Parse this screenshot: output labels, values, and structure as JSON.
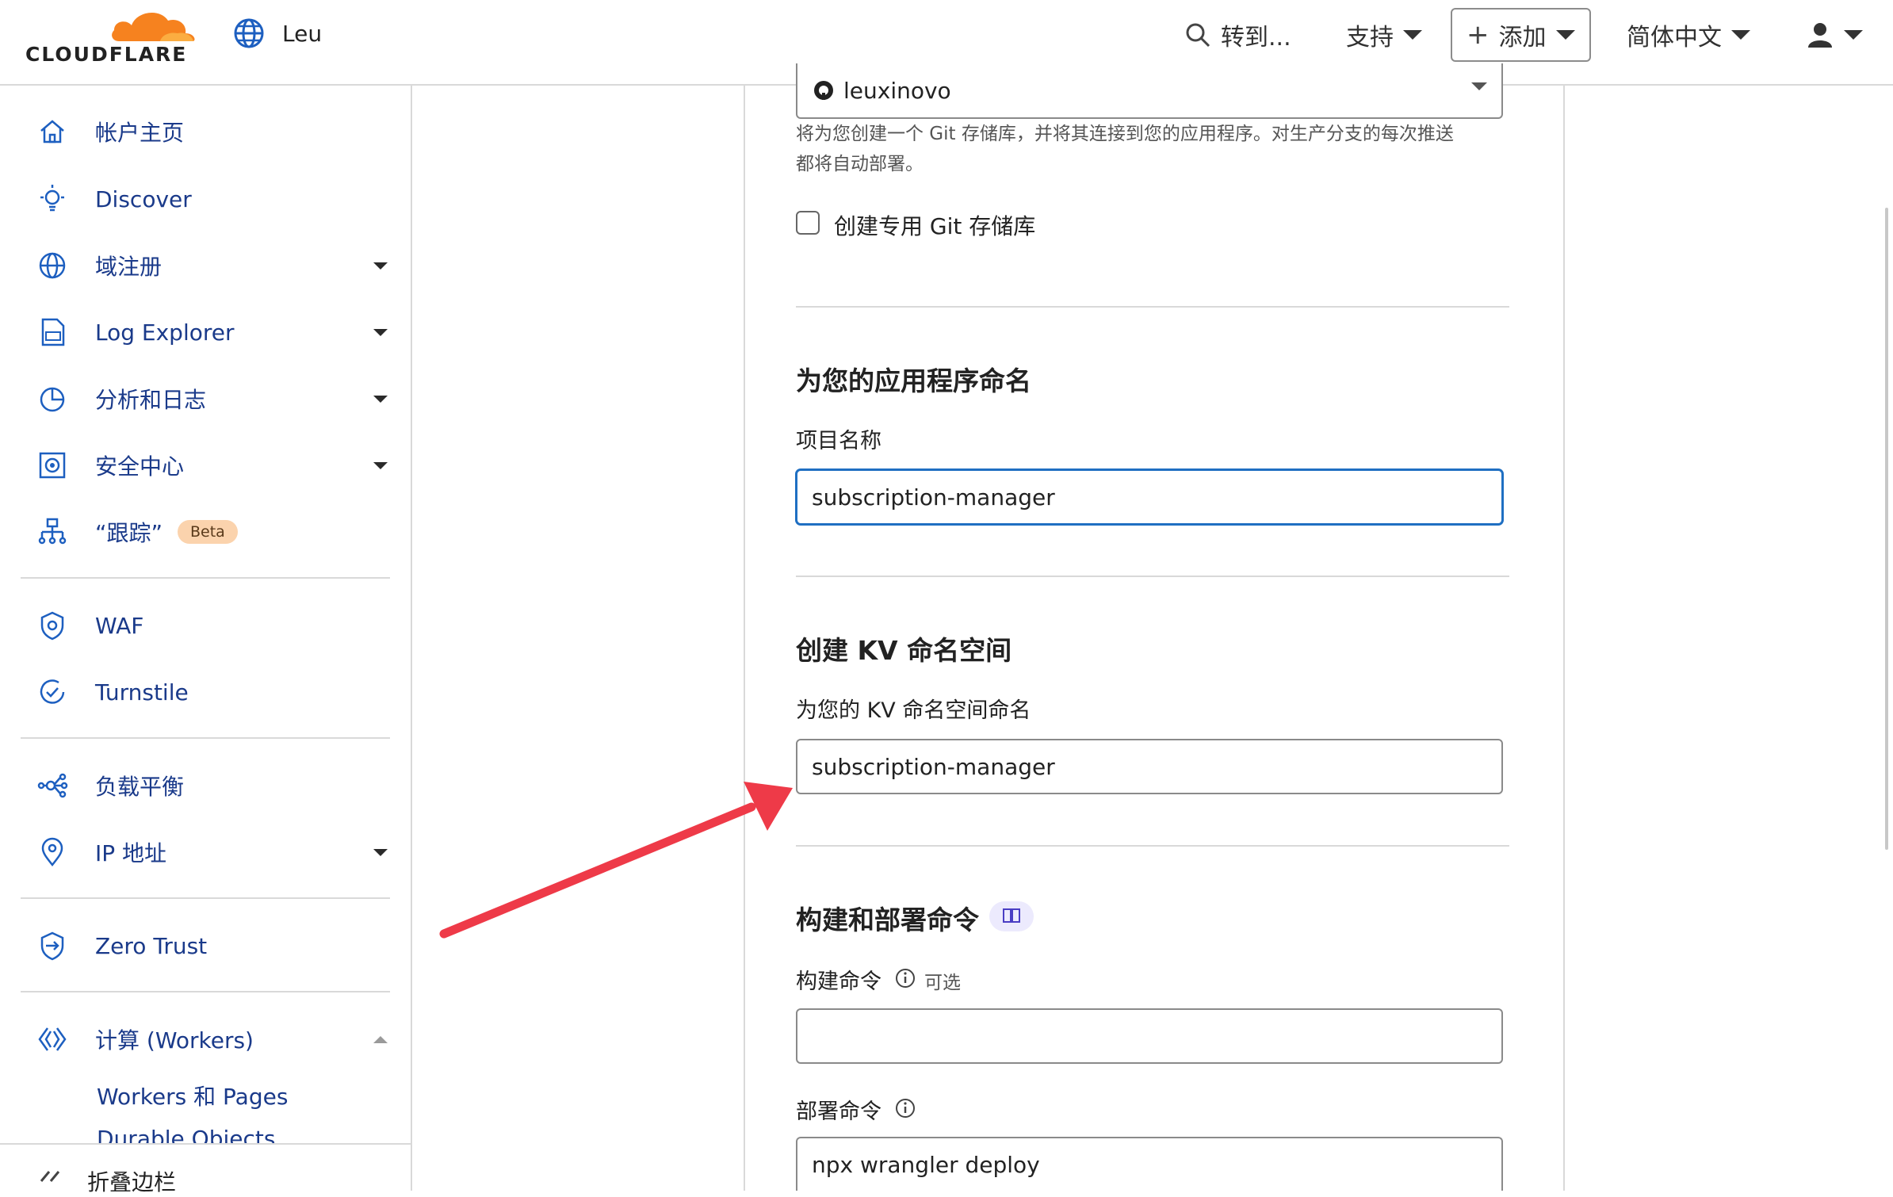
{
  "brand": {
    "logo_text": "CLOUDFLARE",
    "orange": "#f6821f"
  },
  "header": {
    "account_name": "Leu",
    "goto_label": "转到...",
    "support_label": "支持",
    "add_label": "添加",
    "language_label": "简体中文"
  },
  "sidebar": {
    "items": [
      {
        "label": "帐户主页",
        "icon": "home-icon"
      },
      {
        "label": "Discover",
        "icon": "lightbulb-icon"
      },
      {
        "label": "域注册",
        "icon": "globe-icon"
      },
      {
        "label": "Log Explorer",
        "icon": "log-file-icon"
      },
      {
        "label": "分析和日志",
        "icon": "pie-chart-icon"
      },
      {
        "label": "安全中心",
        "icon": "security-center-icon"
      },
      {
        "label": "“跟踪”",
        "icon": "trace-tree-icon",
        "badge": "Beta"
      },
      {
        "label": "WAF",
        "icon": "waf-shield-icon"
      },
      {
        "label": "Turnstile",
        "icon": "turnstile-icon"
      },
      {
        "label": "负载平衡",
        "icon": "load-balance-icon"
      },
      {
        "label": "IP 地址",
        "icon": "location-pin-icon"
      },
      {
        "label": "Zero Trust",
        "icon": "zero-trust-icon"
      },
      {
        "label": "计算 (Workers)",
        "icon": "workers-icon"
      }
    ],
    "sub_items": [
      "Workers 和 Pages",
      "Durable Objects"
    ],
    "collapse_label": "折叠边栏"
  },
  "form": {
    "repo_owner": "leuxinovo",
    "repo_help_line1": "将为您创建一个 Git 存储库，并将其连接到您的应用程序。对生产分支的每次推送",
    "repo_help_line2": "都将自动部署。",
    "private_repo_label": "创建专用 Git 存储库",
    "app_name_title": "为您的应用程序命名",
    "project_name_label": "项目名称",
    "project_name_value": "subscription-manager",
    "kv_title": "创建 KV 命名空间",
    "kv_label": "为您的 KV 命名空间命名",
    "kv_value": "subscription-manager",
    "build_title": "构建和部署命令",
    "build_cmd_label": "构建命令",
    "optional_label": "可选",
    "build_cmd_value": "",
    "deploy_cmd_label": "部署命令",
    "deploy_cmd_value": "npx wrangler deploy"
  },
  "colors": {
    "arrow": "#ee3a48",
    "focus": "#1f6fc2",
    "nav_text": "#1a3a8a",
    "beta_bg": "#fbd3ad"
  }
}
